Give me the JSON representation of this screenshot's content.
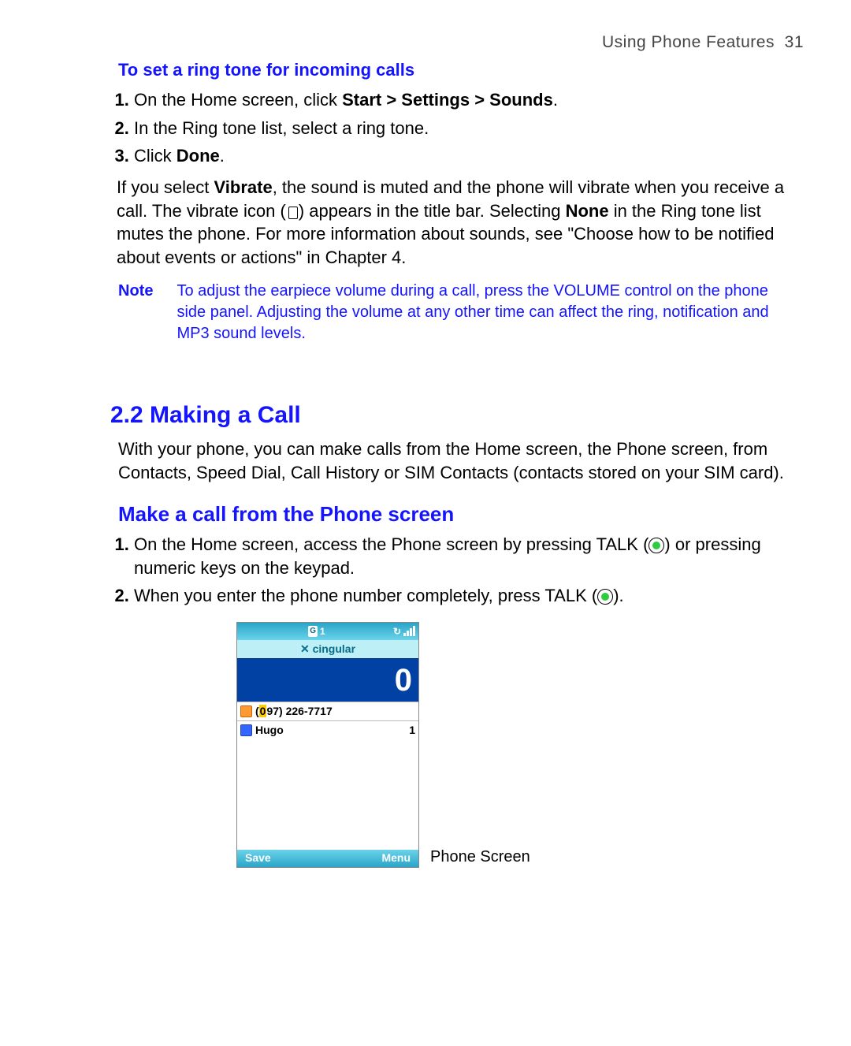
{
  "header": {
    "chapter_label": "Using Phone Features",
    "page_number": "31"
  },
  "sec1": {
    "title": "To set a ring tone for incoming calls",
    "step1_a": "On the Home screen, click ",
    "step1_b": "Start > Settings > Sounds",
    "step1_c": ".",
    "step2": "In the Ring tone list, select a ring tone.",
    "step3_a": "Click ",
    "step3_b": "Done",
    "step3_c": ".",
    "para_a": "If you select ",
    "para_b": "Vibrate",
    "para_c": ", the sound is muted and the phone will vibrate when you receive a call. The vibrate icon (",
    "para_d": ") appears in the title bar. Selecting ",
    "para_e": "None",
    "para_f": " in the Ring tone list mutes the phone. For more information about sounds, see \"Choose how to be notified about events or actions\" in Chapter 4."
  },
  "note": {
    "label": "Note",
    "body": "To adjust the earpiece volume during a call, press the VOLUME control on the phone side panel. Adjusting the volume at any other time can affect the ring, notification and MP3 sound levels."
  },
  "sec2": {
    "number_title": "2.2 Making a Call",
    "intro": "With your phone, you can make calls from the Home screen, the Phone screen, from Contacts, Speed Dial, Call History or SIM Contacts (contacts stored on your SIM card).",
    "h2": "Make a call from the Phone screen",
    "s1_a": "On the Home screen, access the Phone screen by pressing TALK (",
    "s1_b": ") or pressing numeric keys on the keypad.",
    "s2_a": "When you enter the phone number completely, press TALK (",
    "s2_b": ")."
  },
  "phone": {
    "top_g": "G",
    "top_num": "1",
    "carrier": "cingular",
    "big_digit": "0",
    "row1_pre": "0",
    "row1_number": "97) 226-7717",
    "row2_name": "Hugo",
    "row2_count": "1",
    "softkey_left": "Save",
    "softkey_right": "Menu",
    "caption": "Phone Screen"
  }
}
